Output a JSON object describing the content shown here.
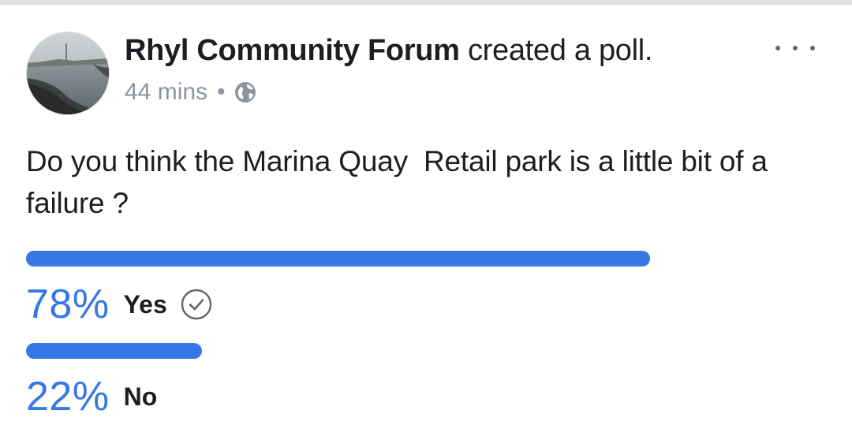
{
  "post": {
    "author": "Rhyl Community Forum",
    "action": " created a poll.",
    "time": "44 mins",
    "separator": "•",
    "privacy_icon": "globe-icon",
    "more_icon": "more-icon"
  },
  "poll": {
    "question": "Do you think the Marina Quay  Retail park is a little bit of a failure ?",
    "options": [
      {
        "percent_label": "78%",
        "label": "Yes",
        "share": 0.78,
        "voted": true
      },
      {
        "percent_label": "22%",
        "label": "No",
        "share": 0.22,
        "voted": false
      }
    ]
  },
  "colors": {
    "accent": "#3578e5",
    "meta_text": "#8d949e",
    "body_text": "#1c1e21"
  }
}
